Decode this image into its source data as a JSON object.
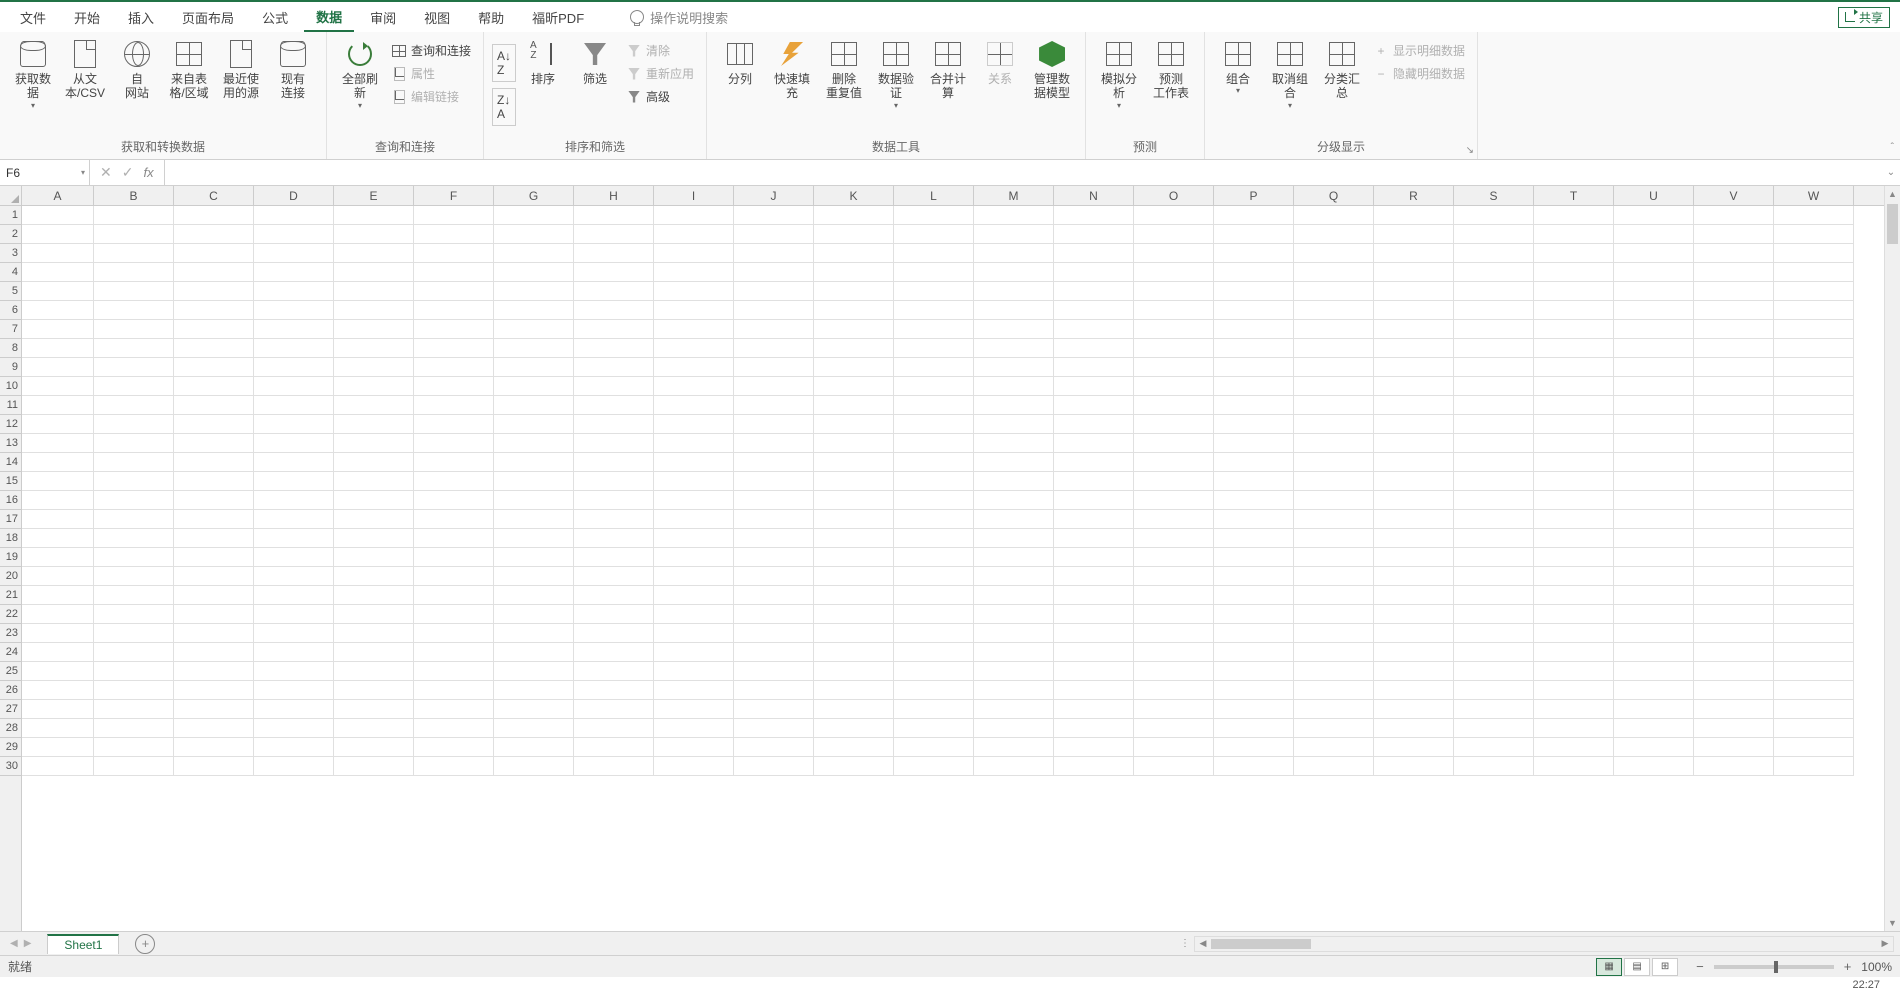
{
  "menu": {
    "tabs": [
      "文件",
      "开始",
      "插入",
      "页面布局",
      "公式",
      "数据",
      "审阅",
      "视图",
      "帮助",
      "福昕PDF"
    ],
    "active_index": 5,
    "search_hint": "操作说明搜索",
    "share": "共享"
  },
  "ribbon": {
    "groups": [
      {
        "name": "获取和转换数据",
        "items": [
          {
            "label": "获取数\n据",
            "type": "big",
            "icon": "db",
            "dropdown": true
          },
          {
            "label": "从文\n本/CSV",
            "type": "big",
            "icon": "doc"
          },
          {
            "label": "自\n网站",
            "type": "big",
            "icon": "globe"
          },
          {
            "label": "来自表\n格/区域",
            "type": "big",
            "icon": "tbl"
          },
          {
            "label": "最近使\n用的源",
            "type": "big",
            "icon": "doc"
          },
          {
            "label": "现有\n连接",
            "type": "big",
            "icon": "db"
          }
        ]
      },
      {
        "name": "查询和连接",
        "items": [
          {
            "label": "全部刷新",
            "type": "big",
            "icon": "refresh",
            "dropdown": true
          },
          {
            "label": "查询和连接",
            "type": "small",
            "icon": "tbl"
          },
          {
            "label": "属性",
            "type": "small",
            "icon": "doc",
            "disabled": true
          },
          {
            "label": "编辑链接",
            "type": "small",
            "icon": "doc",
            "disabled": true
          }
        ]
      },
      {
        "name": "排序和筛选",
        "items": [
          {
            "label": "A↓Z",
            "type": "mini"
          },
          {
            "label": "Z↓A",
            "type": "mini"
          },
          {
            "label": "排序",
            "type": "big",
            "icon": "sort"
          },
          {
            "label": "筛选",
            "type": "big",
            "icon": "funnel"
          },
          {
            "label": "清除",
            "type": "small",
            "icon": "funnel",
            "disabled": true
          },
          {
            "label": "重新应用",
            "type": "small",
            "icon": "funnel",
            "disabled": true
          },
          {
            "label": "高级",
            "type": "small",
            "icon": "funnel"
          }
        ]
      },
      {
        "name": "数据工具",
        "items": [
          {
            "label": "分列",
            "type": "big",
            "icon": "cols"
          },
          {
            "label": "快速填充",
            "type": "big",
            "icon": "flash"
          },
          {
            "label": "删除\n重复值",
            "type": "big",
            "icon": "tbl"
          },
          {
            "label": "数据验\n证",
            "type": "big",
            "icon": "tbl",
            "dropdown": true
          },
          {
            "label": "合并计算",
            "type": "big",
            "icon": "tbl"
          },
          {
            "label": "关系",
            "type": "big",
            "icon": "tbl",
            "disabled": true
          },
          {
            "label": "管理数\n据模型",
            "type": "big",
            "icon": "cube"
          }
        ]
      },
      {
        "name": "预测",
        "items": [
          {
            "label": "模拟分析",
            "type": "big",
            "icon": "tbl",
            "dropdown": true
          },
          {
            "label": "预测\n工作表",
            "type": "big",
            "icon": "tbl"
          }
        ]
      },
      {
        "name": "分级显示",
        "items": [
          {
            "label": "组合",
            "type": "big",
            "icon": "tbl",
            "dropdown": true
          },
          {
            "label": "取消组合",
            "type": "big",
            "icon": "tbl",
            "dropdown": true
          },
          {
            "label": "分类汇总",
            "type": "big",
            "icon": "tbl"
          },
          {
            "label": "显示明细数据",
            "type": "small",
            "icon": "tbl",
            "disabled": true
          },
          {
            "label": "隐藏明细数据",
            "type": "small",
            "icon": "tbl",
            "disabled": true
          }
        ],
        "launcher": true
      }
    ]
  },
  "formula_bar": {
    "name_box": "F6",
    "cancel": "✕",
    "enter": "✓",
    "fx": "fx",
    "value": ""
  },
  "grid": {
    "columns": [
      "A",
      "B",
      "C",
      "D",
      "E",
      "F",
      "G",
      "H",
      "I",
      "J",
      "K",
      "L",
      "M",
      "N",
      "O",
      "P",
      "Q",
      "R",
      "S",
      "T",
      "U",
      "V",
      "W"
    ],
    "rows": 30,
    "active_cell": "F6"
  },
  "sheets": {
    "tabs": [
      "Sheet1"
    ],
    "active_index": 0,
    "add": "+"
  },
  "status": {
    "ready": "就绪",
    "zoom": "100%",
    "clock": "22:27"
  }
}
